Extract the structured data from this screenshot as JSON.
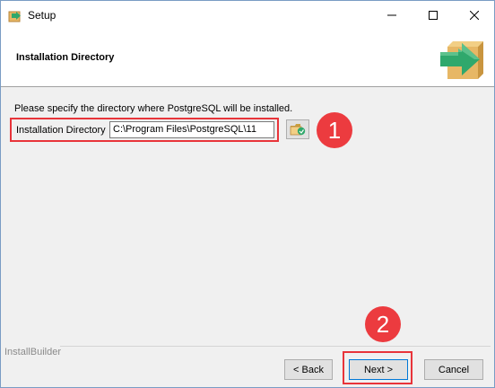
{
  "window": {
    "title": "Setup",
    "controls": {
      "minimize": "minimize",
      "maximize": "maximize",
      "close": "close"
    }
  },
  "header": {
    "title": "Installation Directory",
    "icon": "box-arrow-icon"
  },
  "body": {
    "instruction": "Please specify the directory where PostgreSQL will be installed.",
    "directory_label": "Installation Directory",
    "directory_value": "C:\\Program Files\\PostgreSQL\\11",
    "browse_icon": "folder-browse-icon"
  },
  "annotations": {
    "callout_1": "1",
    "callout_2": "2",
    "color": "#ec3b3f"
  },
  "footer": {
    "brand": "InstallBuilder",
    "back_label": "< Back",
    "next_label": "Next >",
    "cancel_label": "Cancel"
  },
  "colors": {
    "highlight": "#e8343a",
    "icon_green": "#2fa86c",
    "box_tan": "#e7b765"
  }
}
